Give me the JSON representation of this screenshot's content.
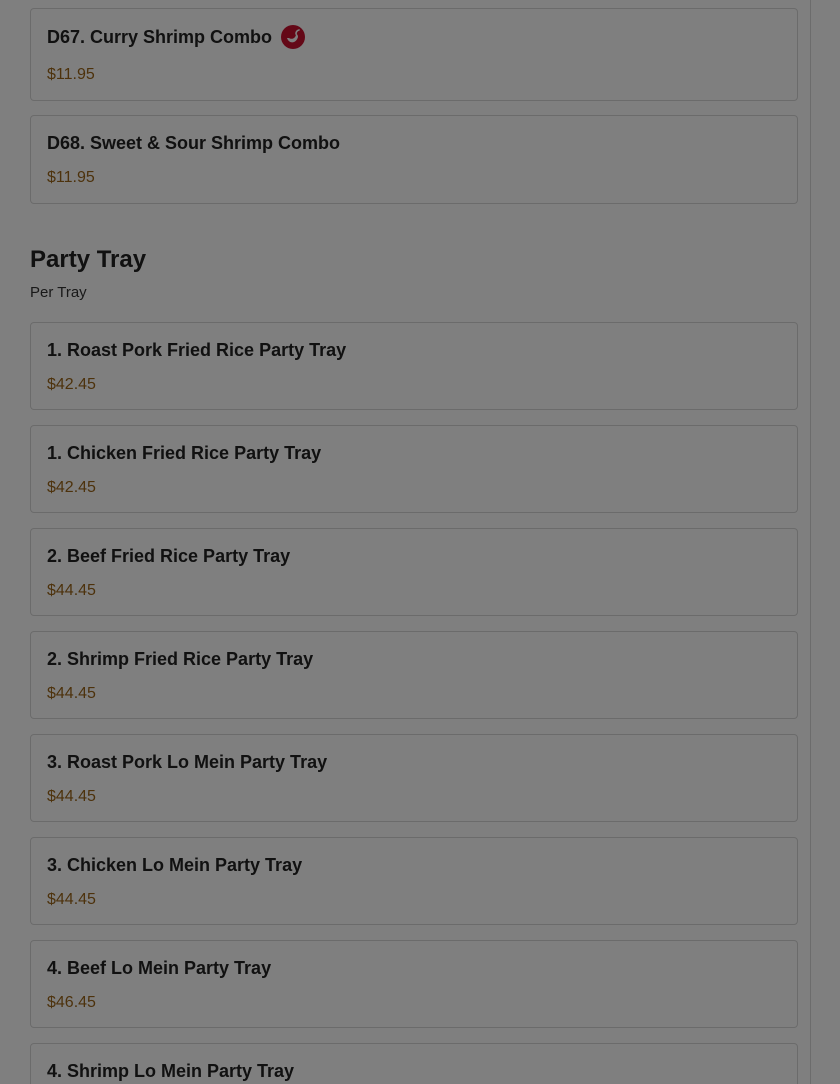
{
  "combo_items": [
    {
      "name": "D67. Curry Shrimp Combo",
      "price": "$11.95",
      "spicy": true
    },
    {
      "name": "D68. Sweet & Sour Shrimp Combo",
      "price": "$11.95",
      "spicy": false
    }
  ],
  "party_tray": {
    "title": "Party Tray",
    "subtitle": "Per Tray",
    "items": [
      {
        "name": "1. Roast Pork Fried Rice Party Tray",
        "price": "$42.45"
      },
      {
        "name": "1. Chicken Fried Rice Party Tray",
        "price": "$42.45"
      },
      {
        "name": "2. Beef Fried Rice Party Tray",
        "price": "$44.45"
      },
      {
        "name": "2. Shrimp Fried Rice Party Tray",
        "price": "$44.45"
      },
      {
        "name": "3. Roast Pork Lo Mein Party Tray",
        "price": "$44.45"
      },
      {
        "name": "3. Chicken Lo Mein Party Tray",
        "price": "$44.45"
      },
      {
        "name": "4. Beef Lo Mein Party Tray",
        "price": "$46.45"
      },
      {
        "name": "4. Shrimp Lo Mein Party Tray",
        "price": ""
      }
    ]
  },
  "colors": {
    "price": "#9a6418",
    "spicy_badge": "#c8102e",
    "overlay": "rgba(0,0,0,0.5)"
  },
  "icons": {
    "spicy": "chili-pepper-icon"
  }
}
